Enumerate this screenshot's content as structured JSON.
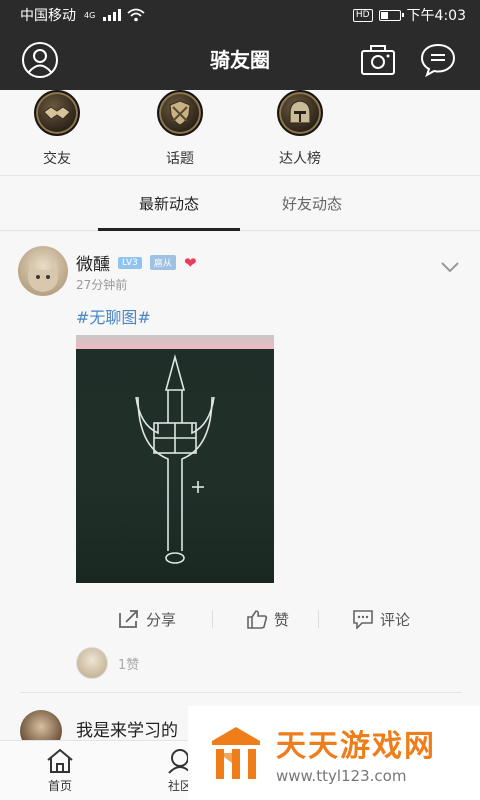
{
  "status_bar": {
    "carrier": "中国移动",
    "network": "4G",
    "hd": "HD",
    "battery_level": 0.45,
    "time": "下午4:03"
  },
  "header": {
    "title": "骑友圈",
    "icons": [
      "user-icon",
      "camera-icon",
      "message-icon"
    ]
  },
  "categories": [
    {
      "label": "交友",
      "icon": "handshake-icon"
    },
    {
      "label": "话题",
      "icon": "shield-icon"
    },
    {
      "label": "达人榜",
      "icon": "helmet-icon"
    }
  ],
  "tabs": [
    {
      "label": "最新动态",
      "active": true
    },
    {
      "label": "好友动态",
      "active": false
    }
  ],
  "post": {
    "username": "微醺",
    "level": "LV3",
    "role": "扈从",
    "time": "27分钟前",
    "topic": "#无聊图#",
    "actions": {
      "share": "分享",
      "like": "赞",
      "comment": "评论"
    },
    "like_count": "1赞"
  },
  "post2": {
    "text": "我是来学习的"
  },
  "bottom_nav": [
    {
      "label": "首页",
      "icon": "home-icon"
    },
    {
      "label": "社区",
      "icon": "community-icon"
    }
  ],
  "watermark": {
    "title": "天天游戏网",
    "url": "www.ttyl123.com"
  },
  "colors": {
    "header_bg": "#2b2b2b",
    "topic": "#4a86c8",
    "heart": "#ef3b5a",
    "watermark": "#ef7d1a"
  }
}
